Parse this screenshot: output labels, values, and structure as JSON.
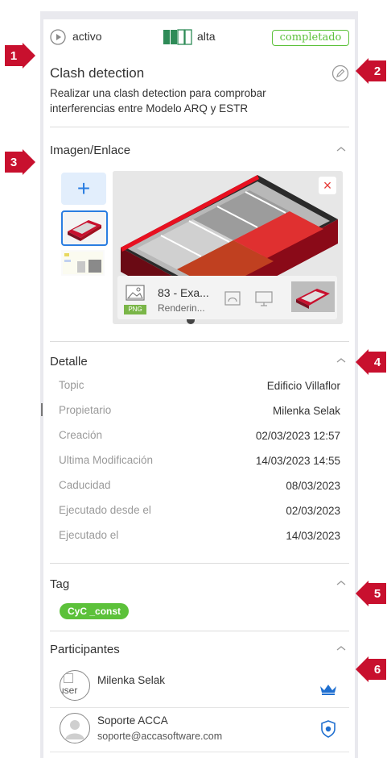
{
  "status": {
    "label": "activo",
    "priority_label": "alta",
    "state_badge": "completado"
  },
  "task": {
    "title": "Clash detection",
    "description_line1": "Realizar una clash detection para comprobar",
    "description_line2": "interferencias entre Modelo ARQ y ESTR"
  },
  "sections": {
    "image_link": "Imagen/Enlace",
    "detail": "Detalle",
    "tag": "Tag",
    "participants": "Participantes"
  },
  "attachment": {
    "name": "83 - Exa...",
    "subtitle": "Renderin...",
    "filetype": "PNG"
  },
  "details": [
    {
      "label": "Topic",
      "value": "Edificio Villaflor"
    },
    {
      "label": "Propietario",
      "value": "Milenka Selak"
    },
    {
      "label": "Creación",
      "value": "02/03/2023 12:57"
    },
    {
      "label": "Ultima Modificación",
      "value": "14/03/2023 14:55"
    },
    {
      "label": "Caducidad",
      "value": "08/03/2023"
    },
    {
      "label": "Ejecutado desde el",
      "value": "02/03/2023"
    },
    {
      "label": "Ejecutado el",
      "value": "14/03/2023"
    }
  ],
  "tags": [
    "CyC _const"
  ],
  "participants": [
    {
      "name": "Milenka Selak",
      "email": "",
      "avatar_alt": "user",
      "role_icon": "crown-icon"
    },
    {
      "name": "Soporte ACCA",
      "email": "soporte@accasoftware.com",
      "avatar_alt": "",
      "role_icon": "shield-icon"
    }
  ],
  "markers": [
    "1",
    "2",
    "3",
    "4",
    "5",
    "6"
  ],
  "colors": {
    "accent_green": "#5cc13a",
    "accent_blue": "#2a7de1",
    "marker_red": "#c8102e",
    "priority_green": "#2e8b57"
  }
}
